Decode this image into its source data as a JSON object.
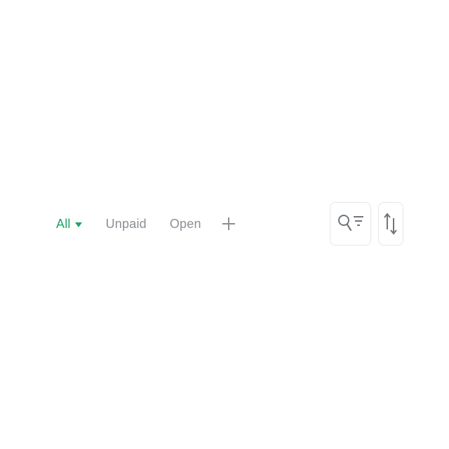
{
  "tabs": [
    {
      "label": "All",
      "active": true,
      "has_dropdown": true
    },
    {
      "label": "Unpaid",
      "active": false
    },
    {
      "label": "Open",
      "active": false
    }
  ],
  "icons": {
    "add_tab": "plus-icon",
    "search_filter": "search-filter-icon",
    "sort": "sort-arrows-icon",
    "dropdown": "caret-down-icon"
  },
  "colors": {
    "accent": "#21a366",
    "inactive_text": "#8a8f94",
    "border": "#e4e6e8",
    "background": "#ffffff"
  }
}
